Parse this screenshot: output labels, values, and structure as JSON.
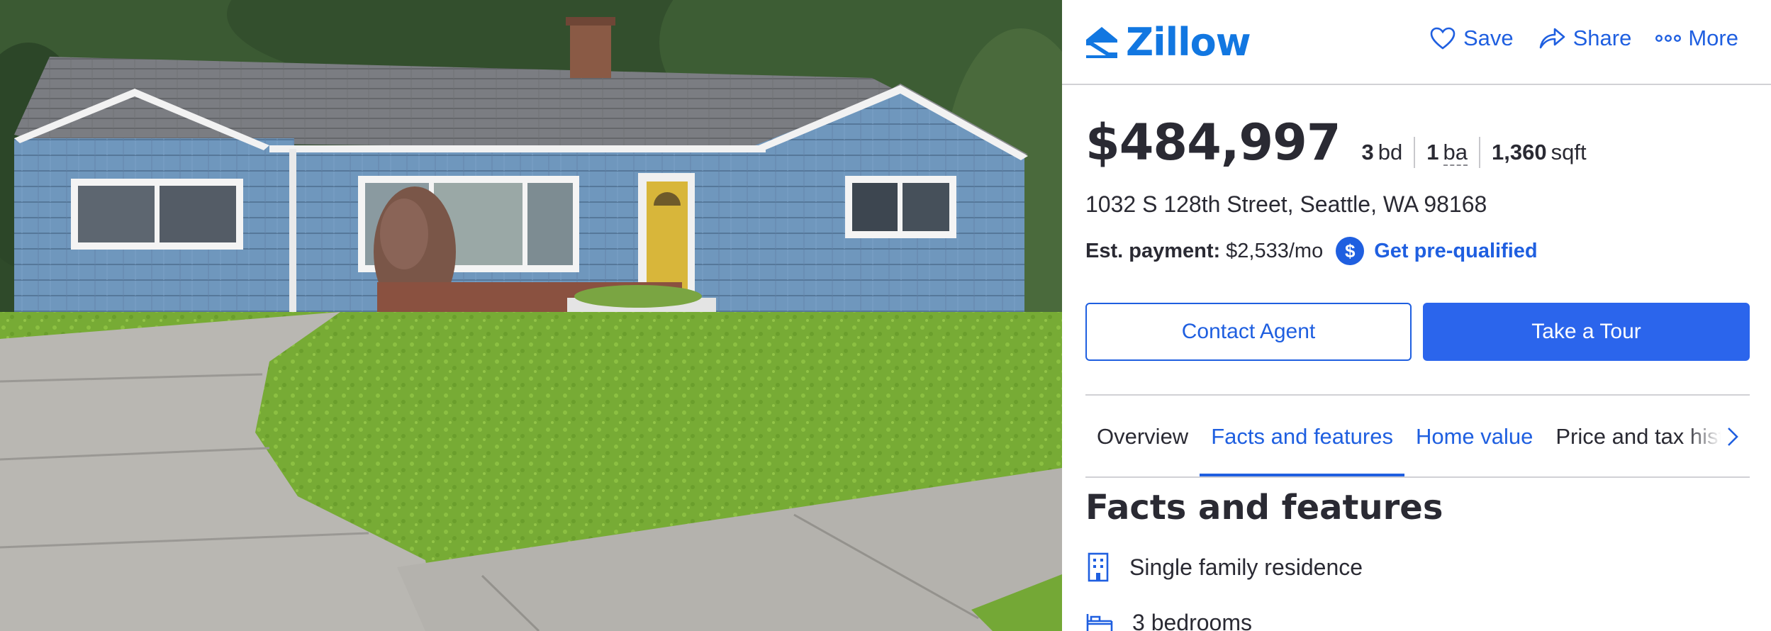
{
  "header": {
    "logo_text": "Zillow",
    "actions": [
      {
        "label": "Save",
        "icon": "heart-icon"
      },
      {
        "label": "Share",
        "icon": "share-icon"
      },
      {
        "label": "More",
        "icon": "more-dots-icon"
      }
    ]
  },
  "listing": {
    "price": "$484,997",
    "beds_value": "3",
    "beds_unit": "bd",
    "baths_value": "1",
    "baths_unit": "ba",
    "sqft_value": "1,360",
    "sqft_unit": "sqft",
    "address": "1032 S 128th Street, Seattle, WA 98168",
    "payment_label": "Est. payment:",
    "payment_value": "$2,533/mo",
    "prequal_icon": "$",
    "prequal_label": "Get pre-qualified"
  },
  "buttons": {
    "contact_agent": "Contact Agent",
    "take_tour": "Take a Tour"
  },
  "tabs": [
    {
      "label": "Overview"
    },
    {
      "label": "Facts and features"
    },
    {
      "label": "Home value"
    },
    {
      "label": "Price and tax history"
    }
  ],
  "facts_section": {
    "title": "Facts and features",
    "items": [
      {
        "icon": "building-icon",
        "label": "Single family residence"
      },
      {
        "icon": "bed-icon",
        "label": "3 bedrooms"
      }
    ]
  },
  "colors": {
    "brand": "#1277e1",
    "accent": "#1f5fe0",
    "button_fill": "#2b65ec",
    "text": "#2a2a33"
  }
}
